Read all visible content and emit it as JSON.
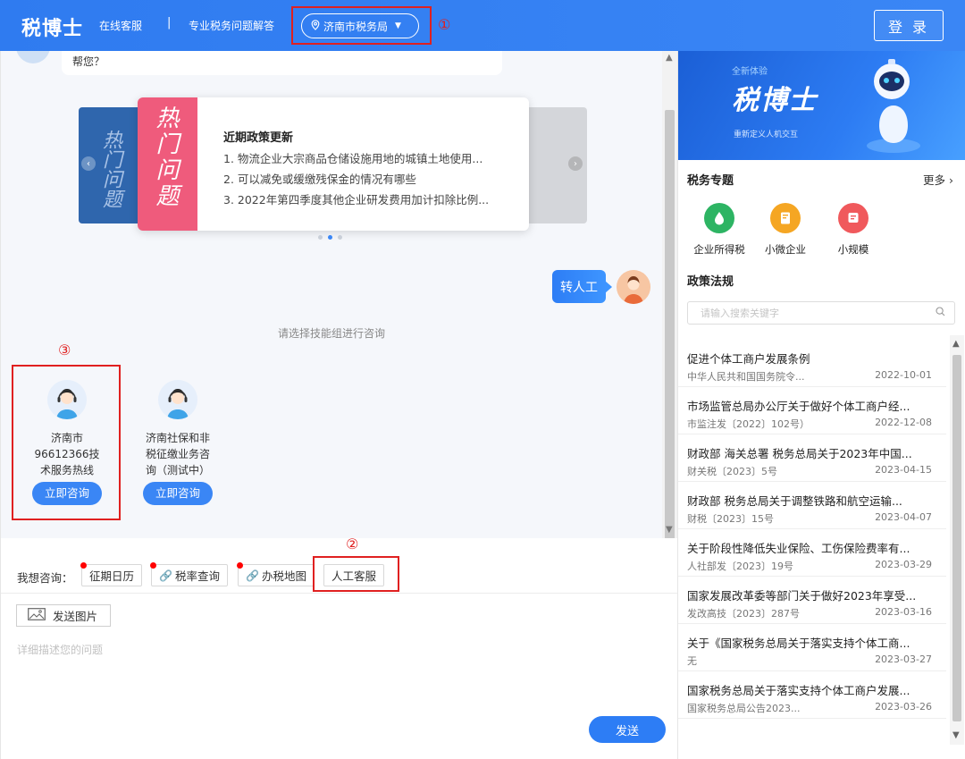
{
  "header": {
    "logo": "税博士",
    "nav_online": "在线客服",
    "nav_sep": "|",
    "nav_pro": "专业税务问题解答",
    "region": "济南市税务局",
    "login": "登 录",
    "marker1": "①"
  },
  "chat": {
    "bot_msg_tail": "帮您？",
    "carousel": {
      "back_left_text": "热门问题",
      "front_badge": [
        "热",
        "门",
        "问",
        "题"
      ],
      "title": "近期政策更新",
      "items": [
        "1. 物流企业大宗商品仓储设施用地的城镇土地使用...",
        "2. 可以减免或缓缴残保金的情况有哪些",
        "3. 2022年第四季度其他企业研发费用加计扣除比例..."
      ],
      "back_right_text": "？"
    },
    "to_human": "转人工",
    "choose_tip": "请选择技能组进行咨询",
    "marker3": "③",
    "agents": [
      {
        "name_lines": [
          "济南市",
          "96612366技",
          "术服务热线"
        ],
        "btn": "立即咨询"
      },
      {
        "name_lines": [
          "济南社保和非",
          "税征缴业务咨",
          "询（测试中）"
        ],
        "btn": "立即咨询"
      }
    ]
  },
  "quick": {
    "label": "我想咨询：",
    "marker2": "②",
    "buttons": [
      "征期日历",
      "税率查询",
      "办税地图",
      "人工客服"
    ]
  },
  "input": {
    "send_image": "发送图片",
    "placeholder": "详细描述您的问题",
    "send": "发送"
  },
  "sidebar": {
    "banner_tag": "全新体验",
    "banner_title": "税博士",
    "banner_sub": "重新定义人机交互",
    "topics_title": "税务专题",
    "more": "更多",
    "topics": [
      {
        "label": "企业所得税",
        "color": "#2db463"
      },
      {
        "label": "小微企业",
        "color": "#f5a623"
      },
      {
        "label": "小规模",
        "color": "#f0595c"
      }
    ],
    "laws_title": "政策法规",
    "search_placeholder": "请输入搜索关键字",
    "laws": [
      {
        "title": "促进个体工商户发展条例",
        "source": "中华人民共和国国务院令...",
        "date": "2022-10-01"
      },
      {
        "title": "市场监管总局办公厅关于做好个体工商户经...",
        "source": "市监注发〔2022〕102号）",
        "date": "2022-12-08"
      },
      {
        "title": "财政部 海关总署 税务总局关于2023年中国...",
        "source": "财关税〔2023〕5号",
        "date": "2023-04-15"
      },
      {
        "title": "财政部 税务总局关于调整铁路和航空运输...",
        "source": "财税〔2023〕15号",
        "date": "2023-04-07"
      },
      {
        "title": "关于阶段性降低失业保险、工伤保险费率有...",
        "source": "人社部发〔2023〕19号",
        "date": "2023-03-29"
      },
      {
        "title": "国家发展改革委等部门关于做好2023年享受...",
        "source": "发改高技〔2023〕287号",
        "date": "2023-03-16"
      },
      {
        "title": "关于《国家税务总局关于落实支持个体工商...",
        "source": "无",
        "date": "2023-03-27"
      },
      {
        "title": "国家税务总局关于落实支持个体工商户发展...",
        "source": "国家税务总局公告2023...",
        "date": "2023-03-26"
      }
    ]
  }
}
